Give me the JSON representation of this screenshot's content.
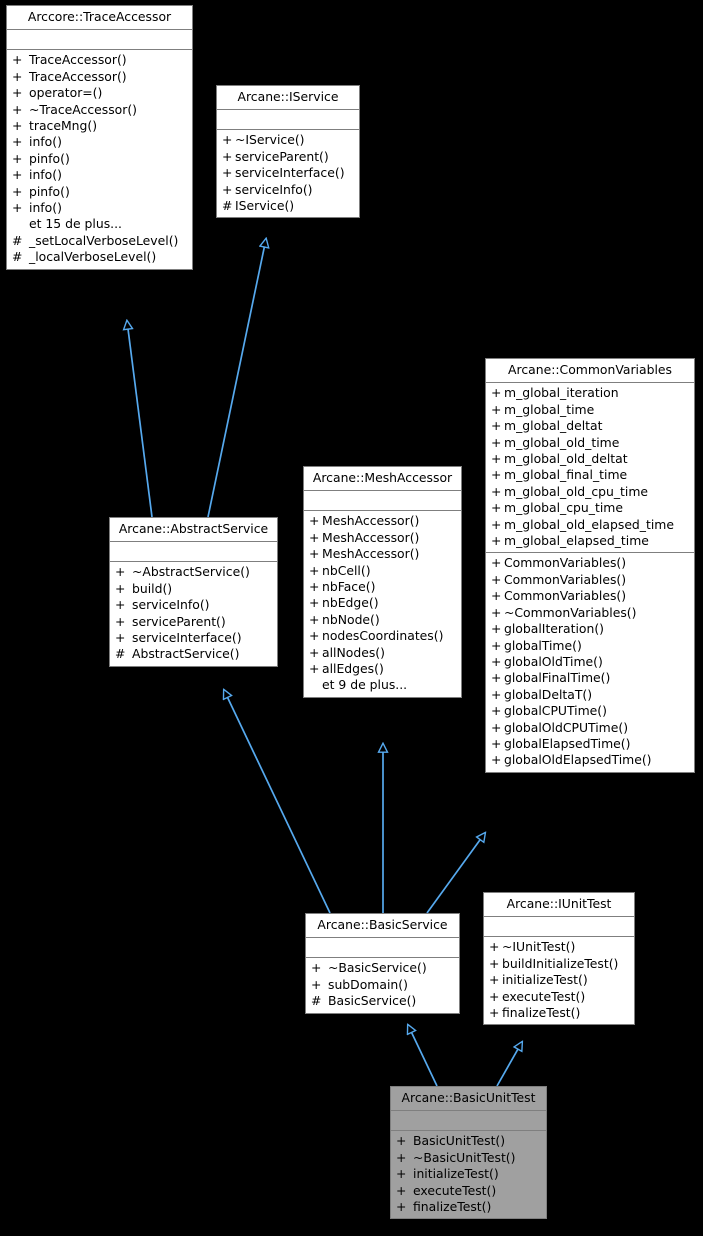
{
  "diagram": {
    "title": "Arcane::BasicUnitTest inheritance diagram",
    "edge_color": "#56a9ee",
    "node_border_color": "#7f7f7f",
    "node_fill": "#ffffff",
    "highlight_fill": "#a0a0a0",
    "background": "#000000",
    "more_label_fr": "et 15 de plus...",
    "relationship": "inheritance"
  },
  "nodes": [
    {
      "id": "trace-accessor",
      "title": "Arccore::TraceAccessor",
      "attributes": [],
      "operations": [
        {
          "vis": "+",
          "name": "TraceAccessor()"
        },
        {
          "vis": "+",
          "name": "TraceAccessor()"
        },
        {
          "vis": "+",
          "name": "operator=()"
        },
        {
          "vis": "+",
          "name": "~TraceAccessor()"
        },
        {
          "vis": "+",
          "name": "traceMng()"
        },
        {
          "vis": "+",
          "name": "info()"
        },
        {
          "vis": "+",
          "name": "pinfo()"
        },
        {
          "vis": "+",
          "name": "info()"
        },
        {
          "vis": "+",
          "name": "pinfo()"
        },
        {
          "vis": "+",
          "name": "info()"
        },
        {
          "vis": "",
          "name": "et 15 de plus..."
        },
        {
          "vis": "#",
          "name": "_setLocalVerboseLevel()"
        },
        {
          "vis": "#",
          "name": "_localVerboseLevel()"
        }
      ]
    },
    {
      "id": "iservice",
      "title": "Arcane::IService",
      "attributes": [],
      "operations": [
        {
          "vis": "+",
          "name": "~IService()"
        },
        {
          "vis": "+",
          "name": "serviceParent()"
        },
        {
          "vis": "+",
          "name": "serviceInterface()"
        },
        {
          "vis": "+",
          "name": "serviceInfo()"
        },
        {
          "vis": "#",
          "name": "IService()"
        }
      ]
    },
    {
      "id": "common-variables",
      "title": "Arcane::CommonVariables",
      "attributes": [
        {
          "vis": "+",
          "name": "m_global_iteration"
        },
        {
          "vis": "+",
          "name": "m_global_time"
        },
        {
          "vis": "+",
          "name": "m_global_deltat"
        },
        {
          "vis": "+",
          "name": "m_global_old_time"
        },
        {
          "vis": "+",
          "name": "m_global_old_deltat"
        },
        {
          "vis": "+",
          "name": "m_global_final_time"
        },
        {
          "vis": "+",
          "name": "m_global_old_cpu_time"
        },
        {
          "vis": "+",
          "name": "m_global_cpu_time"
        },
        {
          "vis": "+",
          "name": "m_global_old_elapsed_time"
        },
        {
          "vis": "+",
          "name": "m_global_elapsed_time"
        }
      ],
      "operations": [
        {
          "vis": "+",
          "name": "CommonVariables()"
        },
        {
          "vis": "+",
          "name": "CommonVariables()"
        },
        {
          "vis": "+",
          "name": "CommonVariables()"
        },
        {
          "vis": "+",
          "name": "~CommonVariables()"
        },
        {
          "vis": "+",
          "name": "globalIteration()"
        },
        {
          "vis": "+",
          "name": "globalTime()"
        },
        {
          "vis": "+",
          "name": "globalOldTime()"
        },
        {
          "vis": "+",
          "name": "globalFinalTime()"
        },
        {
          "vis": "+",
          "name": "globalDeltaT()"
        },
        {
          "vis": "+",
          "name": "globalCPUTime()"
        },
        {
          "vis": "+",
          "name": "globalOldCPUTime()"
        },
        {
          "vis": "+",
          "name": "globalElapsedTime()"
        },
        {
          "vis": "+",
          "name": "globalOldElapsedTime()"
        }
      ]
    },
    {
      "id": "mesh-accessor",
      "title": "Arcane::MeshAccessor",
      "attributes": [],
      "operations": [
        {
          "vis": "+",
          "name": "MeshAccessor()"
        },
        {
          "vis": "+",
          "name": "MeshAccessor()"
        },
        {
          "vis": "+",
          "name": "MeshAccessor()"
        },
        {
          "vis": "+",
          "name": "nbCell()"
        },
        {
          "vis": "+",
          "name": "nbFace()"
        },
        {
          "vis": "+",
          "name": "nbEdge()"
        },
        {
          "vis": "+",
          "name": "nbNode()"
        },
        {
          "vis": "+",
          "name": "nodesCoordinates()"
        },
        {
          "vis": "+",
          "name": "allNodes()"
        },
        {
          "vis": "+",
          "name": "allEdges()"
        },
        {
          "vis": "",
          "name": "et 9 de plus..."
        }
      ]
    },
    {
      "id": "abstract-service",
      "title": "Arcane::AbstractService",
      "attributes": [],
      "operations": [
        {
          "vis": "+",
          "name": "~AbstractService()"
        },
        {
          "vis": "+",
          "name": "build()"
        },
        {
          "vis": "+",
          "name": "serviceInfo()"
        },
        {
          "vis": "+",
          "name": "serviceParent()"
        },
        {
          "vis": "+",
          "name": "serviceInterface()"
        },
        {
          "vis": "#",
          "name": "AbstractService()"
        }
      ]
    },
    {
      "id": "basic-service",
      "title": "Arcane::BasicService",
      "attributes": [],
      "operations": [
        {
          "vis": "+",
          "name": "~BasicService()"
        },
        {
          "vis": "+",
          "name": "subDomain()"
        },
        {
          "vis": "#",
          "name": "BasicService()"
        }
      ]
    },
    {
      "id": "iunittest",
      "title": "Arcane::IUnitTest",
      "attributes": [],
      "operations": [
        {
          "vis": "+",
          "name": "~IUnitTest()"
        },
        {
          "vis": "+",
          "name": "buildInitializeTest()"
        },
        {
          "vis": "+",
          "name": "initializeTest()"
        },
        {
          "vis": "+",
          "name": "executeTest()"
        },
        {
          "vis": "+",
          "name": "finalizeTest()"
        }
      ]
    },
    {
      "id": "basic-unit-test",
      "title": "Arcane::BasicUnitTest",
      "highlight": true,
      "attributes": [],
      "operations": [
        {
          "vis": "+",
          "name": "BasicUnitTest()"
        },
        {
          "vis": "+",
          "name": "~BasicUnitTest()"
        },
        {
          "vis": "+",
          "name": "initializeTest()"
        },
        {
          "vis": "+",
          "name": "executeTest()"
        },
        {
          "vis": "+",
          "name": "finalizeTest()"
        }
      ]
    }
  ],
  "edges": [
    {
      "from": "abstract-service",
      "to": "trace-accessor"
    },
    {
      "from": "abstract-service",
      "to": "iservice"
    },
    {
      "from": "basic-service",
      "to": "abstract-service"
    },
    {
      "from": "basic-service",
      "to": "mesh-accessor"
    },
    {
      "from": "basic-service",
      "to": "common-variables"
    },
    {
      "from": "basic-unit-test",
      "to": "basic-service"
    },
    {
      "from": "basic-unit-test",
      "to": "iunittest"
    }
  ]
}
